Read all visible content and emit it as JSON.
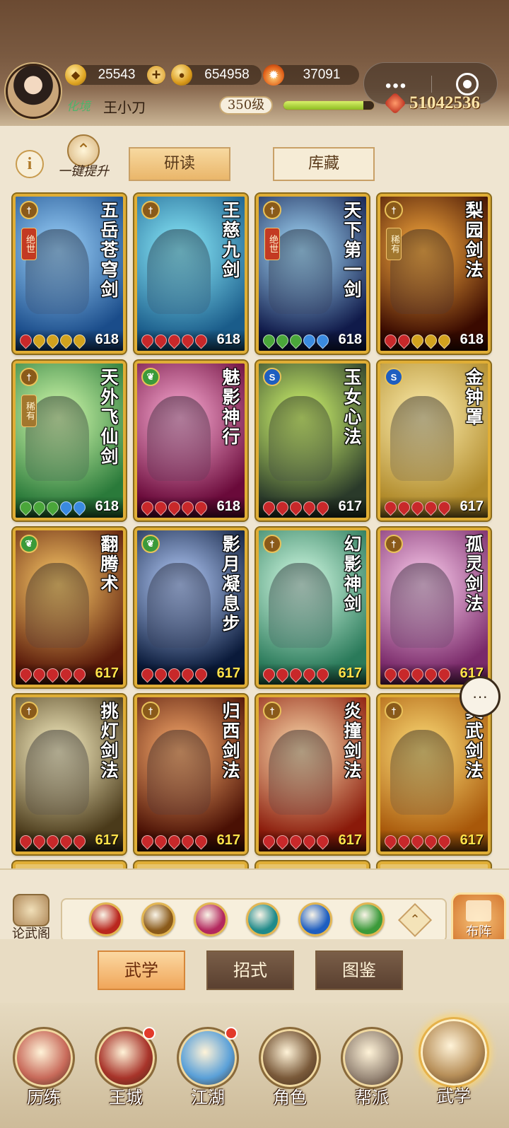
{
  "header": {
    "resources": [
      {
        "icon": "gold-ingot-icon",
        "value": "25543",
        "plus": true
      },
      {
        "icon": "coin-icon",
        "value": "654958",
        "plus": false
      },
      {
        "icon": "flame-icon",
        "value": "37091",
        "plus": false
      }
    ],
    "realm": "化境",
    "player_name": "王小刀",
    "level": "350级",
    "exp_fraction": 0.88,
    "power": "51042536",
    "capsule_dots": "•••"
  },
  "panel": {
    "info_label": "i",
    "upgrade_label": "一键提升",
    "tabs": [
      {
        "label": "研读",
        "active": true
      },
      {
        "label": "库藏",
        "active": false
      }
    ]
  },
  "cards": [
    {
      "title": "五岳苍穹剑",
      "value": "618",
      "tag": "绝世",
      "elem": "sword",
      "art": [
        "#9fd6ff",
        "#1a4c8a"
      ],
      "pips": [
        "#c8282a",
        "#d2a21e",
        "#d2a21e",
        "#d2a21e",
        "#d2a21e"
      ],
      "yellow": false
    },
    {
      "title": "王慈九剑",
      "value": "618",
      "tag": "",
      "elem": "sword",
      "art": [
        "#8ef0ff",
        "#1a5c8a"
      ],
      "pips": [
        "#c8282a",
        "#c8282a",
        "#c8282a",
        "#c8282a",
        "#c8282a"
      ],
      "yellow": false
    },
    {
      "title": "天下第一剑",
      "value": "618",
      "tag": "绝世",
      "elem": "sword",
      "art": [
        "#a8e0ff",
        "#101a4a"
      ],
      "pips": [
        "#4aa63a",
        "#4aa63a",
        "#4aa63a",
        "#3a8ae0",
        "#3a8ae0"
      ],
      "yellow": false
    },
    {
      "title": "梨园剑法",
      "value": "618",
      "tag": "稀有",
      "elem": "sword",
      "art": [
        "#ffb040",
        "#3a0a00"
      ],
      "pips": [
        "#c8282a",
        "#c8282a",
        "#d2a21e",
        "#d2a21e",
        "#d2a21e"
      ],
      "yellow": false
    },
    {
      "title": "天外飞仙剑",
      "value": "618",
      "tag": "稀有",
      "elem": "sword",
      "art": [
        "#d8ffb0",
        "#2a7a3a"
      ],
      "pips": [
        "#4aa63a",
        "#4aa63a",
        "#4aa63a",
        "#3a8ae0",
        "#3a8ae0"
      ],
      "yellow": false
    },
    {
      "title": "魅影神行",
      "value": "618",
      "tag": "",
      "elem": "green",
      "art": [
        "#ffb0d8",
        "#6a0a3a"
      ],
      "pips": [
        "#c8282a",
        "#c8282a",
        "#c8282a",
        "#c8282a",
        "#c8282a"
      ],
      "yellow": false
    },
    {
      "title": "玉女心法",
      "value": "617",
      "tag": "",
      "elem": "blue",
      "art": [
        "#d8ff70",
        "#2a3a2a"
      ],
      "pips": [
        "#c8282a",
        "#c8282a",
        "#c8282a",
        "#c8282a",
        "#c8282a"
      ],
      "yellow": false
    },
    {
      "title": "金钟罩",
      "value": "617",
      "tag": "",
      "elem": "blue",
      "art": [
        "#fff0b0",
        "#b08a2a"
      ],
      "pips": [
        "#c8282a",
        "#c8282a",
        "#c8282a",
        "#c8282a",
        "#c8282a"
      ],
      "yellow": false
    },
    {
      "title": "翻腾术",
      "value": "617",
      "tag": "",
      "elem": "green",
      "art": [
        "#ffce6a",
        "#5a1a0a"
      ],
      "pips": [
        "#c8282a",
        "#c8282a",
        "#c8282a",
        "#c8282a",
        "#c8282a"
      ],
      "yellow": true
    },
    {
      "title": "影月凝息步",
      "value": "617",
      "tag": "",
      "elem": "green",
      "art": [
        "#b8d0ff",
        "#0a1a3a"
      ],
      "pips": [
        "#c8282a",
        "#c8282a",
        "#c8282a",
        "#c8282a",
        "#c8282a"
      ],
      "yellow": true
    },
    {
      "title": "幻影神剑",
      "value": "617",
      "tag": "",
      "elem": "sword",
      "art": [
        "#d8ffe8",
        "#2a7a5a"
      ],
      "pips": [
        "#c8282a",
        "#c8282a",
        "#c8282a",
        "#c8282a",
        "#c8282a"
      ],
      "yellow": true
    },
    {
      "title": "孤灵剑法",
      "value": "617",
      "tag": "",
      "elem": "sword",
      "art": [
        "#ffd0f0",
        "#7a2a6a"
      ],
      "pips": [
        "#c8282a",
        "#c8282a",
        "#c8282a",
        "#c8282a",
        "#c8282a"
      ],
      "yellow": true
    },
    {
      "title": "挑灯剑法",
      "value": "617",
      "tag": "",
      "elem": "sword",
      "art": [
        "#fff6c8",
        "#4a3a1a"
      ],
      "pips": [
        "#c8282a",
        "#c8282a",
        "#c8282a",
        "#c8282a",
        "#c8282a"
      ],
      "yellow": true
    },
    {
      "title": "归西剑法",
      "value": "617",
      "tag": "",
      "elem": "sword",
      "art": [
        "#ffb070",
        "#4a1004"
      ],
      "pips": [
        "#c8282a",
        "#c8282a",
        "#c8282a",
        "#c8282a",
        "#c8282a"
      ],
      "yellow": true
    },
    {
      "title": "炎撞剑法",
      "value": "617",
      "tag": "",
      "elem": "sword",
      "art": [
        "#ffe0b0",
        "#8a1a0a"
      ],
      "pips": [
        "#c8282a",
        "#c8282a",
        "#c8282a",
        "#c8282a",
        "#c8282a"
      ],
      "yellow": true
    },
    {
      "title": "真武剑法",
      "value": "617",
      "tag": "",
      "elem": "sword",
      "art": [
        "#ffe07a",
        "#a8580a"
      ],
      "pips": [
        "#c8282a",
        "#c8282a",
        "#c8282a",
        "#c8282a",
        "#c8282a"
      ],
      "yellow": true
    }
  ],
  "filter": {
    "left_label": "论武阁",
    "right_label": "布阵",
    "buttons": [
      {
        "icon": "blade-icon",
        "color": "#b9271e"
      },
      {
        "icon": "sword-icon",
        "color": "#8a5a1a"
      },
      {
        "icon": "palm-icon",
        "color": "#b3285e"
      },
      {
        "icon": "fan-icon",
        "color": "#1f8a8a"
      },
      {
        "icon": "yin-yang-icon",
        "color": "#1e5ec0"
      },
      {
        "icon": "leaf-icon",
        "color": "#3b9a3a"
      }
    ]
  },
  "subtabs": [
    {
      "label": "武学",
      "active": true
    },
    {
      "label": "招式",
      "active": false
    },
    {
      "label": "图鉴",
      "active": false
    }
  ],
  "nav": [
    {
      "label": "历练",
      "dot": false,
      "active": false,
      "color": "#c86a5a"
    },
    {
      "label": "王城",
      "dot": true,
      "active": false,
      "color": "#a8342a"
    },
    {
      "label": "江湖",
      "dot": true,
      "active": false,
      "color": "#5aa0d8"
    },
    {
      "label": "角色",
      "dot": false,
      "active": false,
      "color": "#7a5a3a"
    },
    {
      "label": "帮派",
      "dot": false,
      "active": false,
      "color": "#9a8a7a"
    },
    {
      "label": "武学",
      "dot": false,
      "active": true,
      "color": "#b8905a"
    }
  ]
}
